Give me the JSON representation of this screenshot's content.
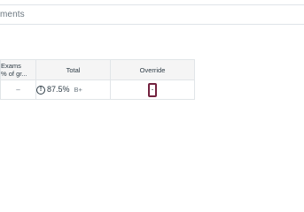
{
  "breadcrumb": {
    "text": "ments"
  },
  "gradebook": {
    "columns": {
      "exams": {
        "line1": "Exams",
        "line2": "% of gr..."
      },
      "total": "Total",
      "override": "Override"
    },
    "row": {
      "exams_value": "–",
      "total_icon": "!",
      "total_percent": "87.5%",
      "total_letter": "B+",
      "override_value": ""
    }
  },
  "icons": {
    "total_status": "warning-icon"
  },
  "colors": {
    "override_focus_border": "#73223f",
    "header_background": "#f5f5f5",
    "border": "#e1e5e8"
  }
}
